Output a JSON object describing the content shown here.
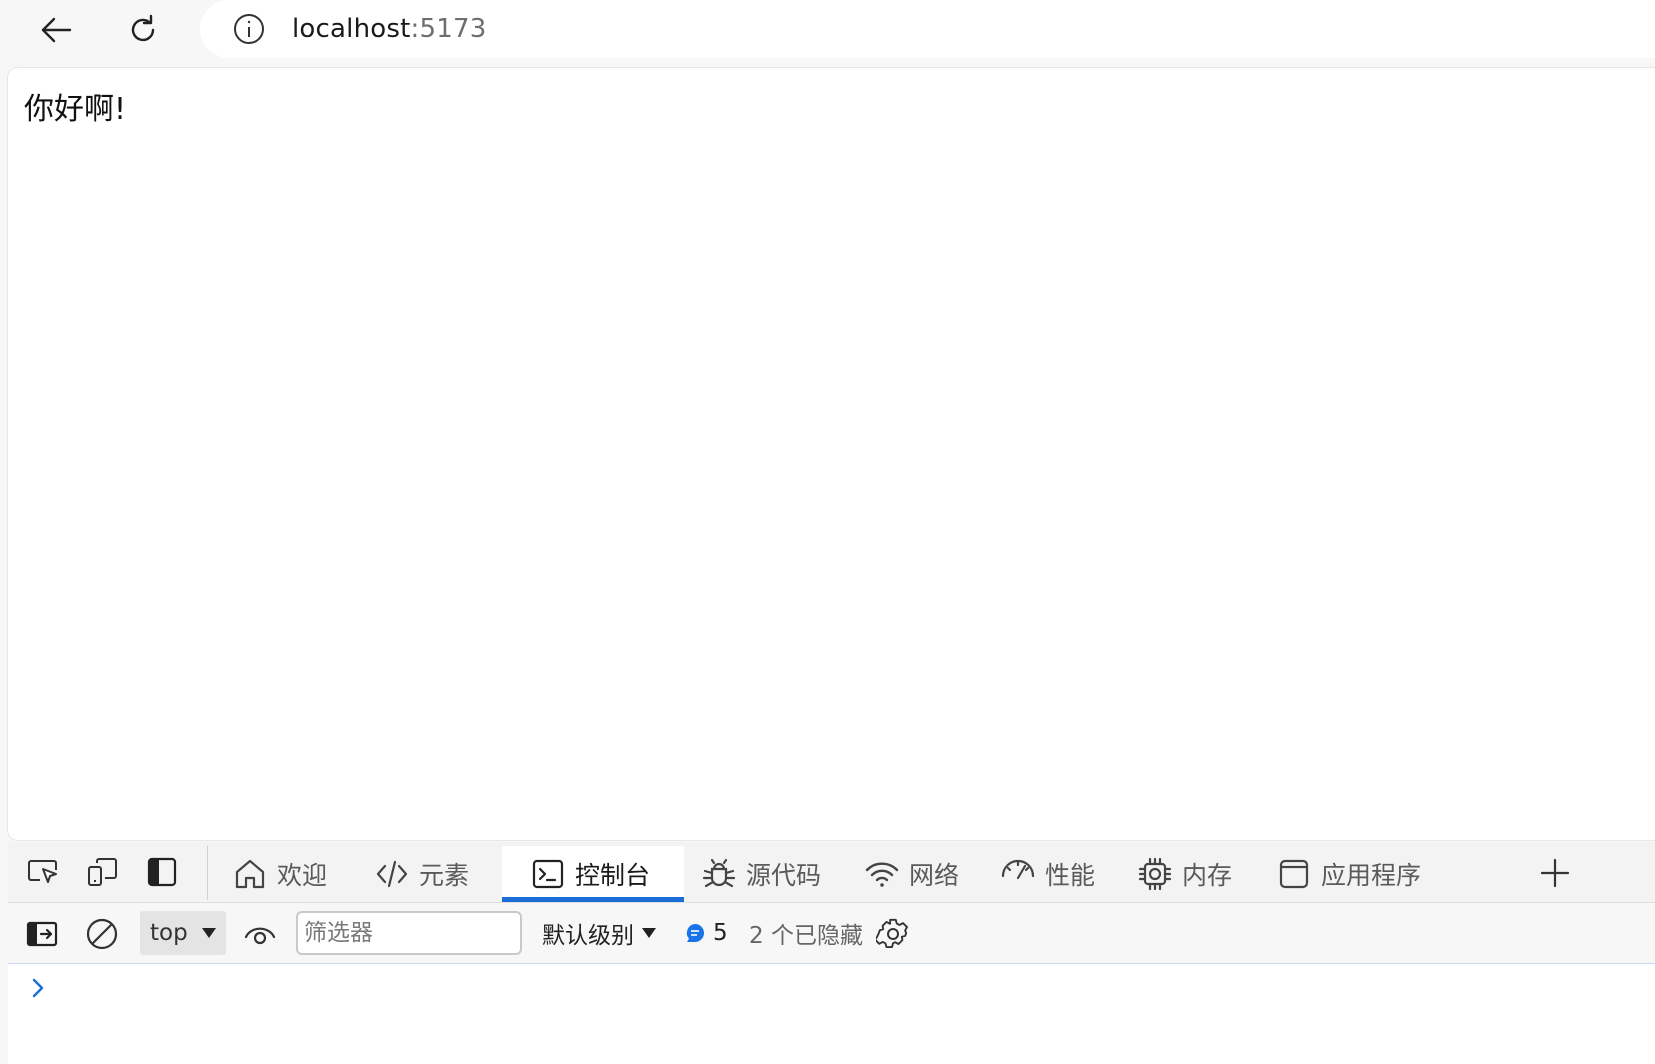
{
  "browser": {
    "address": {
      "host": "localhost",
      "port": ":5173"
    }
  },
  "page": {
    "greeting": "你好啊!"
  },
  "devtools": {
    "tabs": [
      {
        "label": "欢迎",
        "icon": "home-icon",
        "active": false
      },
      {
        "label": "元素",
        "icon": "code-icon",
        "active": false
      },
      {
        "label": "控制台",
        "icon": "console-icon",
        "active": true
      },
      {
        "label": "源代码",
        "icon": "bug-icon",
        "active": false
      },
      {
        "label": "网络",
        "icon": "wifi-icon",
        "active": false
      },
      {
        "label": "性能",
        "icon": "gauge-icon",
        "active": false
      },
      {
        "label": "内存",
        "icon": "chip-icon",
        "active": false
      },
      {
        "label": "应用程序",
        "icon": "app-window-icon",
        "active": false
      }
    ],
    "console": {
      "context": "top",
      "filter_placeholder": "筛选器",
      "levels_label": "默认级别",
      "message_count": "5",
      "hidden_label": "2 个已隐藏"
    }
  },
  "colors": {
    "accent": "#1a6dd6",
    "message_badge": "#1a73e8",
    "prompt": "#1a6dd6"
  }
}
